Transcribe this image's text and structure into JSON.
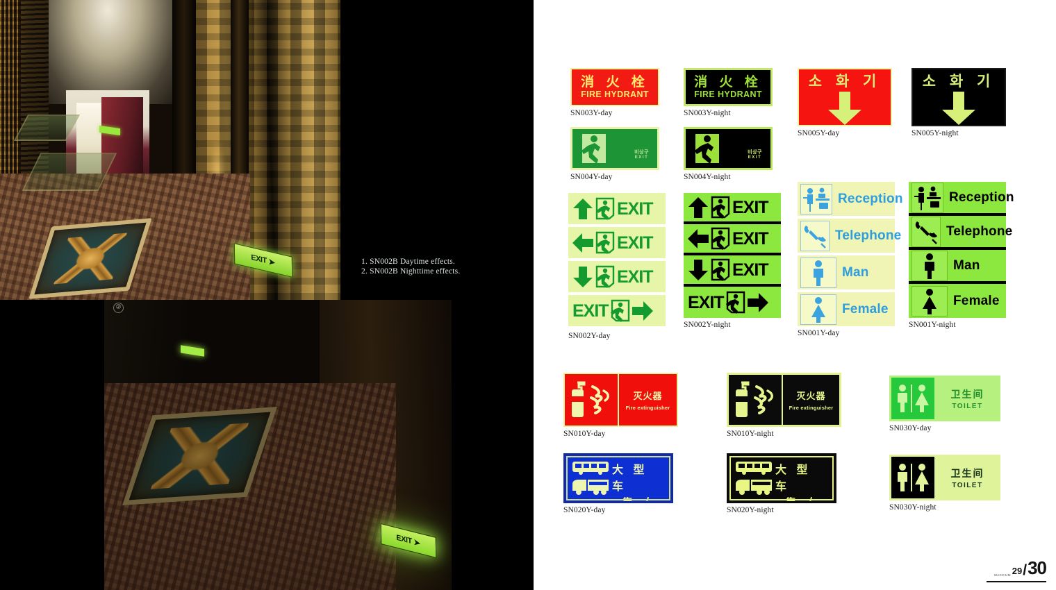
{
  "document": {
    "type": "catalog-spread",
    "page_number_current": "29",
    "page_number_total": "30",
    "page_brand_mark": "MACCIUM"
  },
  "left_page": {
    "captions": [
      "1. SN002B  Daytime effects.",
      "2. SN002B  Nighttime effects."
    ],
    "photo_day": {
      "name": "hotel-corridor-daytime",
      "exit_sign_text": "EXIT",
      "marker": ""
    },
    "photo_night": {
      "name": "hotel-corridor-nighttime",
      "exit_sign_text": "EXIT",
      "marker": "②"
    }
  },
  "right_page": {
    "signs": [
      {
        "id": "sn003y-day",
        "caption": "SN003Y-day",
        "mode": "day",
        "title_cn": "消 火 栓",
        "title_en": "FIRE HYDRANT",
        "bg": "#f21b14",
        "fg": "#ffe96f"
      },
      {
        "id": "sn003y-night",
        "caption": "SN003Y-night",
        "mode": "night",
        "title_cn": "消 火 栓",
        "title_en": "FIRE HYDRANT",
        "bg": "#000000",
        "fg": "#9ee03a"
      },
      {
        "id": "sn004y-day",
        "caption": "SN004Y-day",
        "mode": "day",
        "korean": "비상구",
        "title_en": "EXIT",
        "bg": "#1d9435",
        "fg": "#c3e9a0"
      },
      {
        "id": "sn004y-night",
        "caption": "SN004Y-night",
        "mode": "night",
        "korean": "비상구",
        "title_en": "EXIT",
        "bg": "#000000",
        "fg": "#9ee03a"
      },
      {
        "id": "sn005y-day",
        "caption": "SN005Y-day",
        "mode": "day",
        "title_kr": "소 화 기",
        "bg": "#f51410",
        "fg": "#d6f07a"
      },
      {
        "id": "sn005y-night",
        "caption": "SN005Y-night",
        "mode": "night",
        "title_kr": "소 화 기",
        "bg": "#000000",
        "fg": "#d6f07a"
      },
      {
        "id": "sn002y-day",
        "caption": "SN002Y-day",
        "mode": "day",
        "bg": "#e7f5a8",
        "fg": "#149a2f",
        "rows": [
          {
            "arrow": "up",
            "label": "EXIT",
            "order": "arrow-door-text"
          },
          {
            "arrow": "left",
            "label": "EXIT",
            "order": "arrow-door-text"
          },
          {
            "arrow": "down",
            "label": "EXIT",
            "order": "arrow-door-text"
          },
          {
            "arrow": "right",
            "label": "EXIT",
            "order": "text-door-arrow"
          }
        ]
      },
      {
        "id": "sn002y-night",
        "caption": "SN002Y-night",
        "mode": "night",
        "bg": "#8ce83f",
        "fg": "#000000",
        "rows": [
          {
            "arrow": "up",
            "label": "EXIT",
            "order": "arrow-door-text"
          },
          {
            "arrow": "left",
            "label": "EXIT",
            "order": "arrow-door-text"
          },
          {
            "arrow": "down",
            "label": "EXIT",
            "order": "arrow-door-text"
          },
          {
            "arrow": "right",
            "label": "EXIT",
            "order": "text-door-arrow"
          }
        ]
      },
      {
        "id": "sn001y-day",
        "caption": "SN001Y-day",
        "mode": "day",
        "bg": "#f0f4b4",
        "fg": "#2f9ede",
        "rows": [
          {
            "icon": "reception-icon",
            "label": "Reception"
          },
          {
            "icon": "telephone-icon",
            "label": "Telephone"
          },
          {
            "icon": "man-icon",
            "label": "Man"
          },
          {
            "icon": "female-icon",
            "label": "Female"
          }
        ]
      },
      {
        "id": "sn001y-night",
        "caption": "SN001Y-night",
        "mode": "night",
        "bg": "#8ce83f",
        "fg": "#000000",
        "rows": [
          {
            "icon": "reception-icon",
            "label": "Reception"
          },
          {
            "icon": "telephone-icon",
            "label": "Telephone"
          },
          {
            "icon": "man-icon",
            "label": "Man"
          },
          {
            "icon": "female-icon",
            "label": "Female"
          }
        ]
      },
      {
        "id": "sn010y-day",
        "caption": "SN010Y-day",
        "mode": "day",
        "title_cn": "灭火器",
        "title_en": "Fire extinguisher",
        "bg": "#f00f0a",
        "fg": "#f2f7b0"
      },
      {
        "id": "sn010y-night",
        "caption": "SN010Y-night",
        "mode": "night",
        "title_cn": "灭火器",
        "title_en": "Fire extinguisher",
        "bg": "#0b0b0b",
        "fg": "#e6f58c"
      },
      {
        "id": "sn030y-day",
        "caption": "SN030Y-day",
        "mode": "day",
        "title_cn": "卫生间",
        "title_en": "TOILET",
        "bg": "#b6f07e",
        "fg": "#1f8f2d"
      },
      {
        "id": "sn030y-night",
        "caption": "SN030Y-night",
        "mode": "night",
        "title_cn": "卫生间",
        "title_en": "TOILET",
        "bg": "#dff39a",
        "fg": "#16331a"
      },
      {
        "id": "sn020y-day",
        "caption": "SN020Y-day",
        "mode": "day",
        "line1_cn": "大 型 车",
        "line2_cn": "靠 右",
        "bg": "#0e2fd1",
        "fg": "#eef5b0"
      },
      {
        "id": "sn020y-night",
        "caption": "SN020Y-night",
        "mode": "night",
        "line1_cn": "大 型 车",
        "line2_cn": "靠 右",
        "bg": "#0a0a0a",
        "fg": "#e9f682"
      }
    ]
  }
}
